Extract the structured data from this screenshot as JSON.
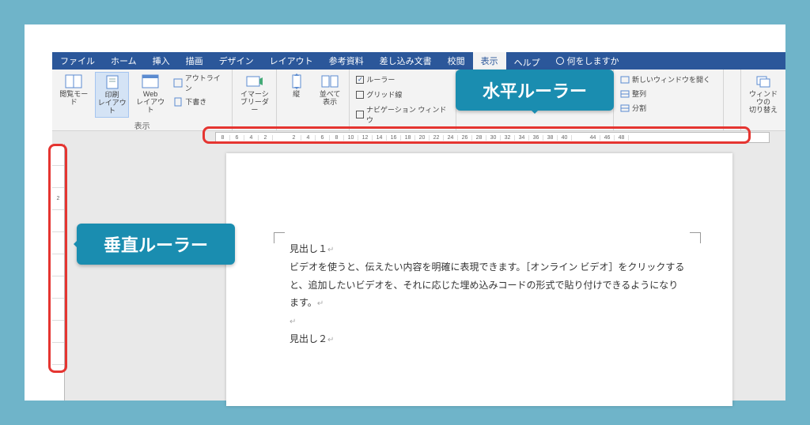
{
  "tabs": {
    "file": "ファイル",
    "home": "ホーム",
    "insert": "挿入",
    "draw": "描画",
    "design": "デザイン",
    "layout": "レイアウト",
    "references": "参考資料",
    "mailings": "差し込み文書",
    "review": "校閲",
    "view": "表示",
    "help": "ヘルプ",
    "tellme": "何をしますか"
  },
  "ribbon": {
    "views_label": "表示",
    "read": "閲覧モード",
    "print": "印刷\nレイアウト",
    "web": "Web\nレイアウト",
    "outline": "アウトライン",
    "draft": "下書き",
    "immersive": "イマーシ\nブリーダー",
    "vertical": "縦",
    "sidebyside": "並べて\n表示",
    "ruler": "ルーラー",
    "gridlines": "グリッド線",
    "navpane": "ナビゲーション ウィンドウ",
    "newwindow": "新しいウィンドウを開く",
    "arrange": "整列",
    "split": "分割",
    "switch": "ウィンドウの\n切り替え"
  },
  "callouts": {
    "horizontal": "水平ルーラー",
    "vertical": "垂直ルーラー"
  },
  "doc": {
    "h1": "見出し１",
    "p1": "ビデオを使うと、伝えたい内容を明確に表現できます。［オンライン ビデオ］をクリックすると、追加したいビデオを、それに応じた埋め込みコードの形式で貼り付けできるようになります。",
    "h2": "見出し２"
  },
  "hruler_ticks": [
    "8",
    "6",
    "4",
    "2",
    "",
    "2",
    "4",
    "6",
    "8",
    "10",
    "12",
    "14",
    "16",
    "18",
    "20",
    "22",
    "24",
    "26",
    "28",
    "30",
    "32",
    "34",
    "36",
    "38",
    "40",
    "",
    "44",
    "46",
    "48"
  ],
  "vruler_ticks": [
    "",
    "",
    "2",
    "",
    "",
    "",
    "",
    "",
    "",
    ""
  ]
}
